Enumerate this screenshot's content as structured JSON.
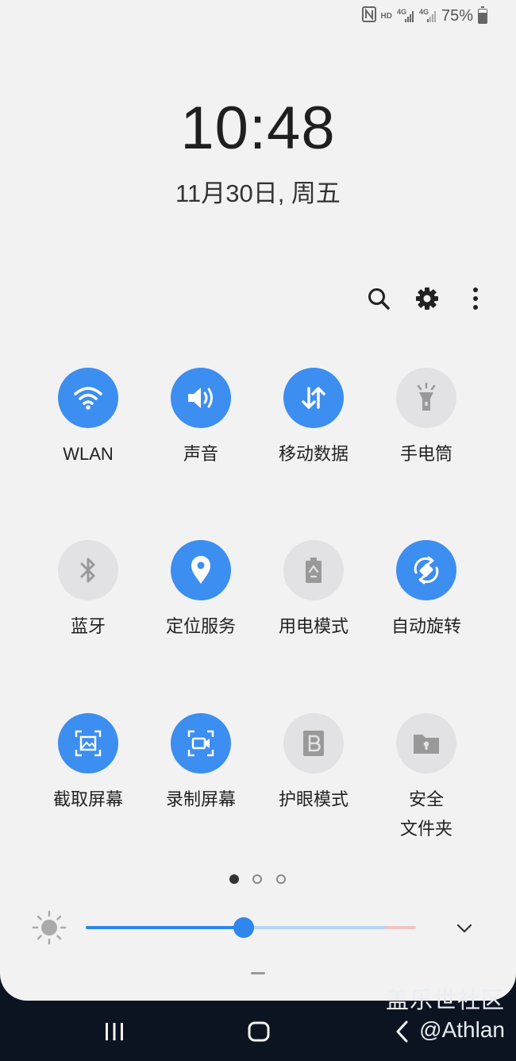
{
  "status_bar": {
    "nfc_icon": "nfc-icon",
    "hd_label": "HD",
    "signal1_label": "4G",
    "signal2_label": "4G",
    "battery_text": "75%"
  },
  "lockscreen": {
    "time": "10:48",
    "date": "11月30日, 周五"
  },
  "quick_actions": [
    "search-icon",
    "gear-icon",
    "more-vertical-icon"
  ],
  "tiles": [
    {
      "label": "WLAN",
      "icon": "wifi-icon",
      "active": true
    },
    {
      "label": "声音",
      "icon": "speaker-icon",
      "active": true
    },
    {
      "label": "移动数据",
      "icon": "data-transfer-icon",
      "active": true
    },
    {
      "label": "手电筒",
      "icon": "flashlight-icon",
      "active": false
    },
    {
      "label": "蓝牙",
      "icon": "bluetooth-icon",
      "active": false
    },
    {
      "label": "定位服务",
      "icon": "location-icon",
      "active": true
    },
    {
      "label": "用电模式",
      "icon": "battery-recycle-icon",
      "active": false
    },
    {
      "label": "自动旋转",
      "icon": "auto-rotate-icon",
      "active": true
    },
    {
      "label": "截取屏幕",
      "icon": "screenshot-icon",
      "active": true
    },
    {
      "label": "录制屏幕",
      "icon": "screen-record-icon",
      "active": true
    },
    {
      "label": "护眼模式",
      "icon": "blue-light-filter-icon",
      "active": false
    },
    {
      "label_line1": "安全",
      "label_line2": "文件夹",
      "icon": "secure-folder-icon",
      "active": false
    }
  ],
  "pagination": {
    "pages": 3,
    "current": 1
  },
  "brightness": {
    "level": 0.42,
    "icon": "sun-icon",
    "expand_icon": "chevron-down-icon"
  },
  "watermark": {
    "line1": "盖乐世社区",
    "line2": "@Athlan"
  },
  "navbar": {
    "recents_icon": "recents-icon",
    "home_icon": "home-icon",
    "back_icon": "back-icon"
  },
  "colors": {
    "accent": "#3c8ef0",
    "tile_off": "#e2e2e4",
    "panel_bg": "#f2f2f3",
    "navbar_bg": "#0d1421"
  }
}
